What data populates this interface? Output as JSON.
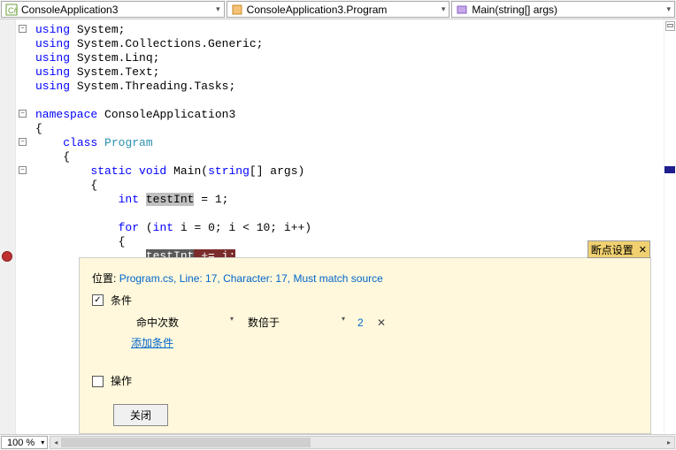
{
  "nav": {
    "combo1": "ConsoleApplication3",
    "combo2": "ConsoleApplication3.Program",
    "combo3": "Main(string[] args)"
  },
  "code": {
    "usings": [
      "System",
      "System.Collections.Generic",
      "System.Linq",
      "System.Text",
      "System.Threading.Tasks"
    ],
    "ns_kw": "namespace",
    "ns_name": "ConsoleApplication3",
    "class_kw": "class",
    "class_name": "Program",
    "method_mods": "static void",
    "method_name": "Main",
    "method_params_kw": "string",
    "method_params_rest": "[] args",
    "decl_kw": "int",
    "decl_name": "testInt",
    "decl_rest": "= 1;",
    "for_kw": "for",
    "for_int": "int",
    "for_rest1": "i = 0; i < 10; i++)",
    "stmt_var": "testInt",
    "stmt_rest": " += i;"
  },
  "breakpoint": {
    "title": "断点设置",
    "loc_label": "位置:",
    "loc_link": "Program.cs, Line: 17, Character: 17, Must match source",
    "cond_label": "条件",
    "hit_label": "命中次数",
    "mult_label": "数倍于",
    "mult_value": "2",
    "add_cond": "添加条件",
    "action_label": "操作",
    "close_btn": "关闭"
  },
  "zoom": "100 %"
}
